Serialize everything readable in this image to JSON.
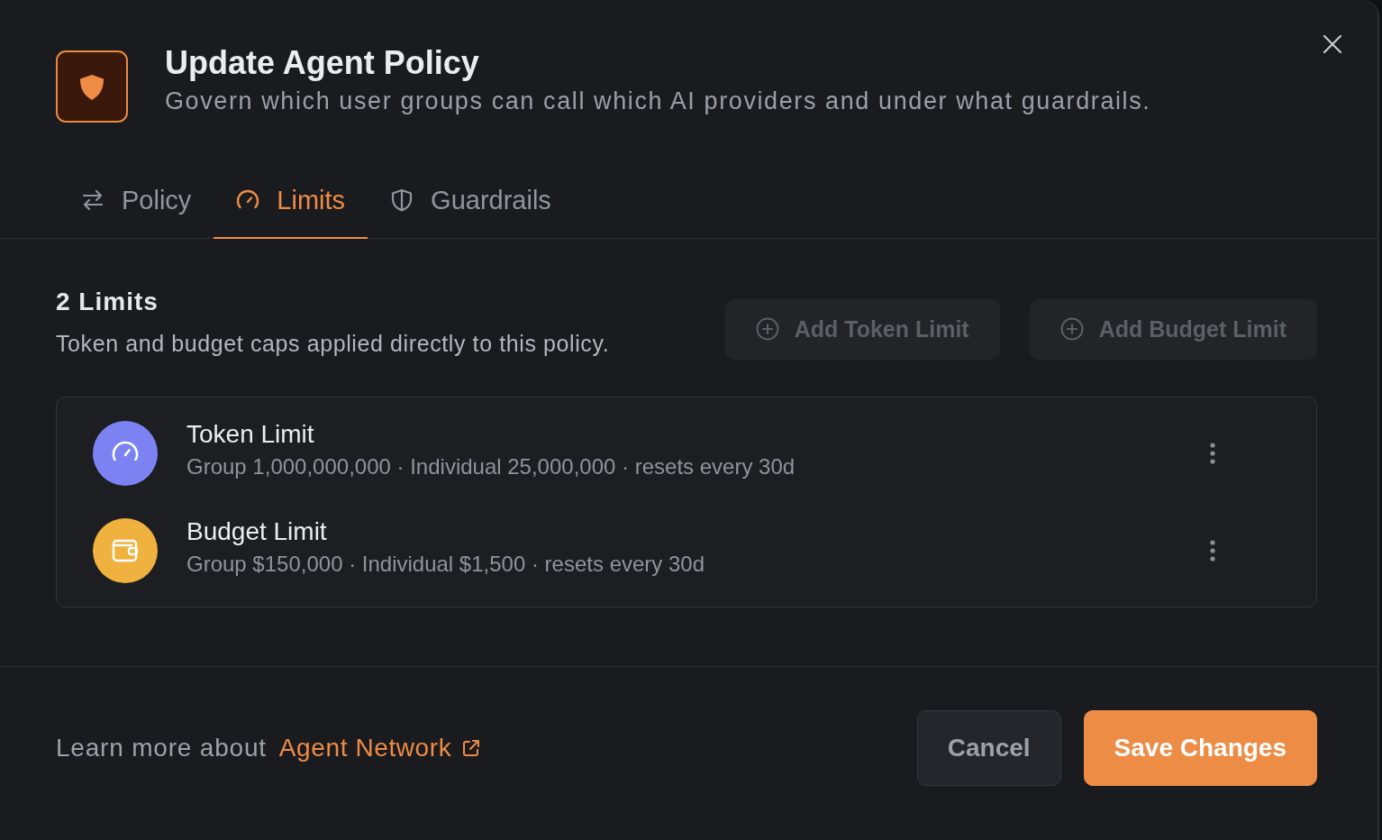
{
  "dialog": {
    "title": "Update Agent Policy",
    "subtitle": "Govern which user groups can call which AI providers and under what guardrails."
  },
  "tabs": [
    {
      "label": "Policy",
      "selected": false
    },
    {
      "label": "Limits",
      "selected": true
    },
    {
      "label": "Guardrails",
      "selected": false
    }
  ],
  "limits_section": {
    "heading": "2 Limits",
    "description": "Token and budget caps applied directly to this policy.",
    "buttons": [
      {
        "label": "Add Token Limit",
        "disabled": true
      },
      {
        "label": "Add Budget Limit",
        "disabled": true
      }
    ]
  },
  "limits": [
    {
      "kind": "token",
      "name": "Token Limit",
      "detail": "Group 1,000,000,000 · Individual 25,000,000 · resets every 30d",
      "color": "#7c82f2"
    },
    {
      "kind": "budget",
      "name": "Budget Limit",
      "detail": "Group $150,000 · Individual $1,500 · resets every 30d",
      "color": "#f0b23e"
    }
  ],
  "footer": {
    "learn_more": "Learn more about",
    "link": "Agent Network",
    "buttons": [
      {
        "kind": "secondary",
        "label": "Cancel"
      },
      {
        "kind": "primary",
        "label": "Save Changes"
      }
    ]
  }
}
